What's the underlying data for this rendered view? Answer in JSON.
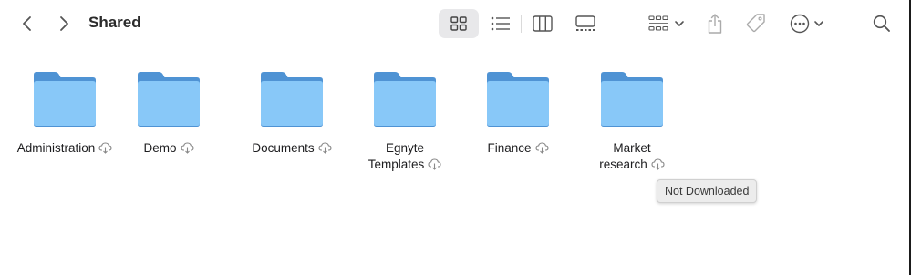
{
  "window": {
    "title": "Shared"
  },
  "toolbar": {
    "back_icon": "chevron-left-icon",
    "forward_icon": "chevron-right-icon",
    "views": [
      "icon-view",
      "list-view",
      "column-view",
      "gallery-view"
    ],
    "selected_view": "icon-view",
    "accent_selected_bg": "#e8e8ea"
  },
  "folders": [
    {
      "name": "Administration",
      "lines": [
        "Administration"
      ],
      "status_icon": "cloud-download-icon"
    },
    {
      "name": "Demo",
      "lines": [
        "Demo"
      ],
      "status_icon": "cloud-download-icon"
    },
    {
      "name": "Documents",
      "lines": [
        "Documents"
      ],
      "status_icon": "cloud-download-icon"
    },
    {
      "name": "Egnyte Templates",
      "lines": [
        "Egnyte",
        "Templates"
      ],
      "status_icon": "cloud-download-icon"
    },
    {
      "name": "Finance",
      "lines": [
        "Finance"
      ],
      "status_icon": "cloud-download-icon"
    },
    {
      "name": "Market research",
      "lines": [
        "Market",
        "research"
      ],
      "status_icon": "cloud-download-icon"
    }
  ],
  "folder_color": "#7cc2f5",
  "tooltip": {
    "text": "Not Downloaded"
  }
}
